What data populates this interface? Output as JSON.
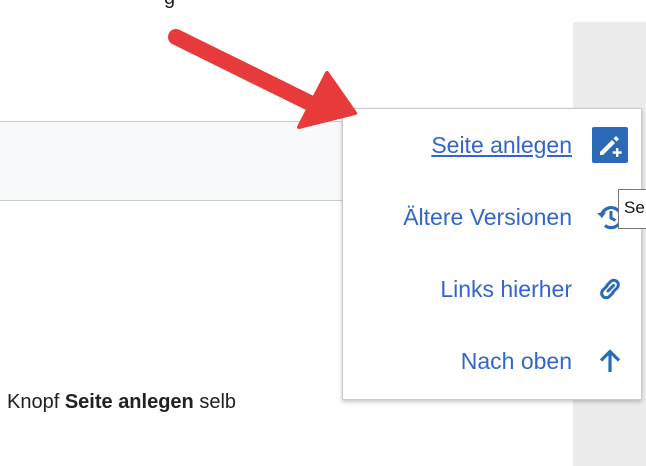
{
  "top": {
    "partial_text": "g"
  },
  "content": {
    "body_prefix": "Knopf ",
    "body_bold": "Seite anlegen",
    "body_suffix": " selb"
  },
  "menu": {
    "items": [
      {
        "label": "Seite anlegen",
        "icon": "edit-plus-icon"
      },
      {
        "label": "Ältere Versionen",
        "icon": "history-icon"
      },
      {
        "label": "Links hierher",
        "icon": "link-icon"
      },
      {
        "label": "Nach oben",
        "icon": "arrow-up-icon"
      }
    ]
  },
  "tooltip": {
    "text": "Se"
  },
  "colors": {
    "link": "#3366cc",
    "icon_box": "#2a6ab7",
    "annotation_arrow": "#e8393b"
  }
}
